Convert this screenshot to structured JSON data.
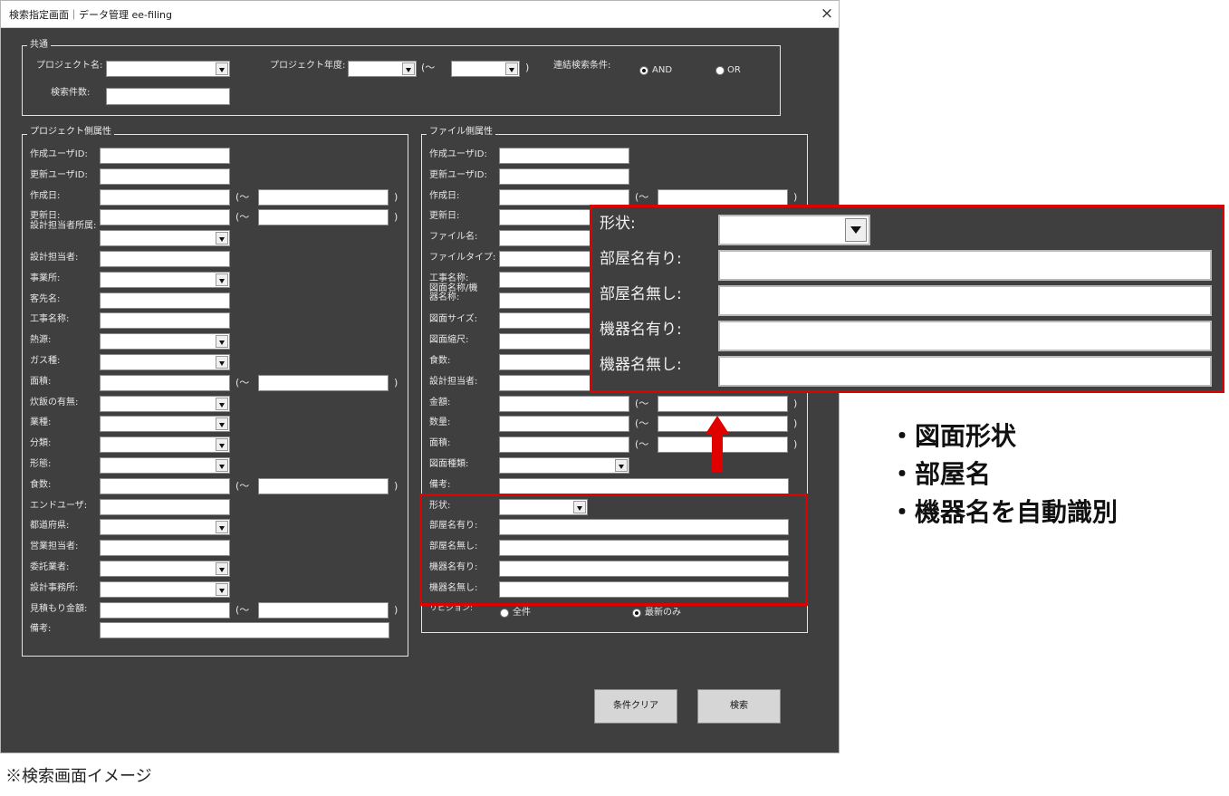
{
  "window": {
    "title": "検索指定画面｜データ管理 ee-filing",
    "close": "×"
  },
  "common": {
    "legend": "共通",
    "project_name": "プロジェクト名:",
    "project_year": "プロジェクト年度:",
    "paren_open": "(～",
    "paren_close": ")",
    "link_condition": "連結検索条件:",
    "and": "AND",
    "or": "OR",
    "search_count": "検索件数:"
  },
  "tilde_open": "(～",
  "tilde_close": ")",
  "project_attr": {
    "legend": "プロジェクト側属性",
    "rows": [
      "作成ユーザID:",
      "更新ユーザID:",
      "作成日:",
      "更新日:",
      "設計担当者所属:",
      "設計担当者:",
      "事業所:",
      "客先名:",
      "工事名称:",
      "熱源:",
      "ガス種:",
      "面積:",
      "炊飯の有無:",
      "業種:",
      "分類:",
      "形態:",
      "食数:",
      "エンドユーザ:",
      "都道府県:",
      "営業担当者:",
      "委託業者:",
      "設計事務所:",
      "見積もり金額:",
      "備考:"
    ]
  },
  "file_attr": {
    "legend": "ファイル側属性",
    "rows": [
      "作成ユーザID:",
      "更新ユーザID:",
      "作成日:",
      "更新日:",
      "ファイル名:",
      "ファイルタイプ:",
      "工事名称:",
      "図面名称/機器名称:",
      "図面サイズ:",
      "図面縮尺:",
      "食数:",
      "設計担当者:",
      "金額:",
      "数量:",
      "面積:",
      "図面種類:",
      "備考:",
      "形状:",
      "部屋名有り:",
      "部屋名無し:",
      "機器名有り:",
      "機器名無し:"
    ],
    "revision": "リビジョン:",
    "all": "全件",
    "latest": "最新のみ"
  },
  "buttons": {
    "clear": "条件クリア",
    "search": "検索"
  },
  "zoom": {
    "shape": "形状:",
    "room_yes": "部屋名有り:",
    "room_no": "部屋名無し:",
    "equip_yes": "機器名有り:",
    "equip_no": "機器名無し:"
  },
  "bullets": [
    "・図面形状",
    "・部屋名",
    "・機器名を自動識別"
  ],
  "caption": "※検索画面イメージ",
  "colors": {
    "window_bg": "#3f3f3f",
    "highlight": "#e00000"
  }
}
